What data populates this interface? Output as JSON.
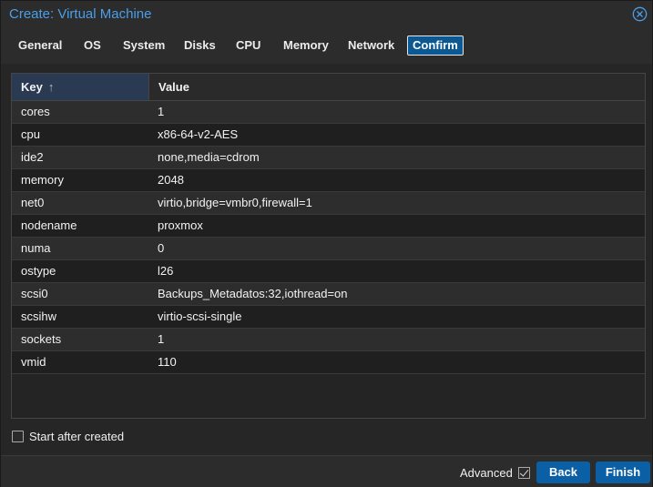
{
  "window": {
    "title": "Create: Virtual Machine"
  },
  "tabs": [
    {
      "label": "General"
    },
    {
      "label": "OS"
    },
    {
      "label": "System"
    },
    {
      "label": "Disks"
    },
    {
      "label": "CPU"
    },
    {
      "label": "Memory"
    },
    {
      "label": "Network"
    },
    {
      "label": "Confirm",
      "active": true
    }
  ],
  "grid": {
    "headers": {
      "key": "Key",
      "value": "Value"
    },
    "sort_icon": "sort-ascending-arrow",
    "rows": [
      {
        "key": "cores",
        "value": "1"
      },
      {
        "key": "cpu",
        "value": "x86-64-v2-AES"
      },
      {
        "key": "ide2",
        "value": "none,media=cdrom"
      },
      {
        "key": "memory",
        "value": "2048"
      },
      {
        "key": "net0",
        "value": "virtio,bridge=vmbr0,firewall=1"
      },
      {
        "key": "nodename",
        "value": "proxmox"
      },
      {
        "key": "numa",
        "value": "0"
      },
      {
        "key": "ostype",
        "value": "l26"
      },
      {
        "key": "scsi0",
        "value": "Backups_Metadatos:32,iothread=on"
      },
      {
        "key": "scsihw",
        "value": "virtio-scsi-single"
      },
      {
        "key": "sockets",
        "value": "1"
      },
      {
        "key": "vmid",
        "value": "110"
      }
    ]
  },
  "start_after_created": {
    "label": "Start after created",
    "checked": false
  },
  "footer": {
    "advanced_label": "Advanced",
    "advanced_checked": true,
    "back_label": "Back",
    "finish_label": "Finish"
  },
  "colors": {
    "accent": "#4c9ee8",
    "button": "#0b5fa5",
    "active_tab": "#0b5892",
    "background": "#2c2c2c"
  }
}
